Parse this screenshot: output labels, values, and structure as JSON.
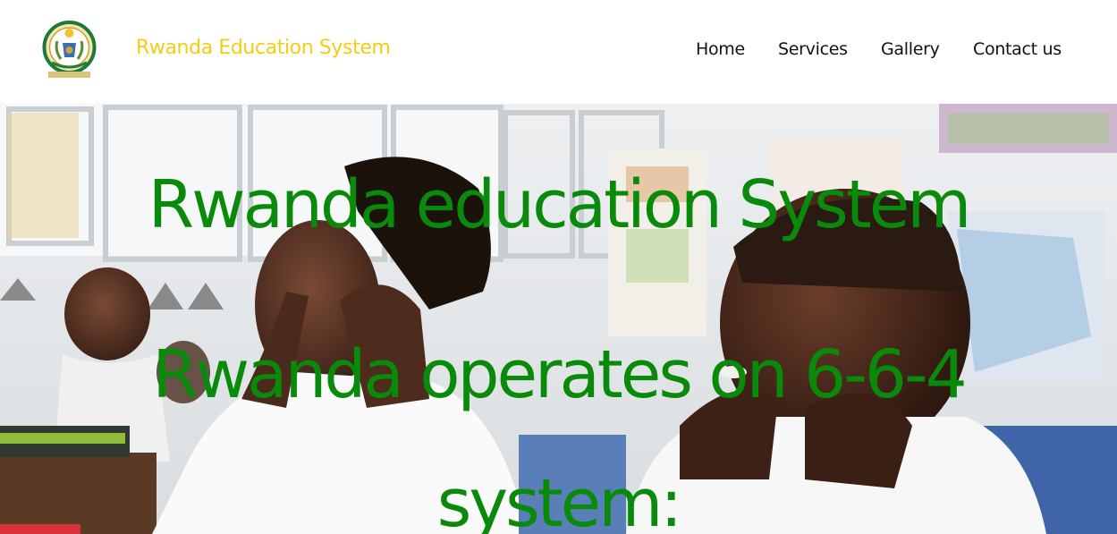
{
  "header": {
    "logo_icon": "rwanda-coat-of-arms",
    "brand": "Rwanda Education System",
    "brand_color": "#f5cc15"
  },
  "nav": {
    "items": [
      {
        "label": "Home"
      },
      {
        "label": "Services"
      },
      {
        "label": "Gallery"
      },
      {
        "label": "Contact us"
      }
    ]
  },
  "hero": {
    "background": "classroom-children-photo",
    "title": "Rwanda education System",
    "subtitle_line1": "Rwanda operates on 6-6-4",
    "subtitle_line2": "system:",
    "text_color": "#0a8a0a"
  }
}
